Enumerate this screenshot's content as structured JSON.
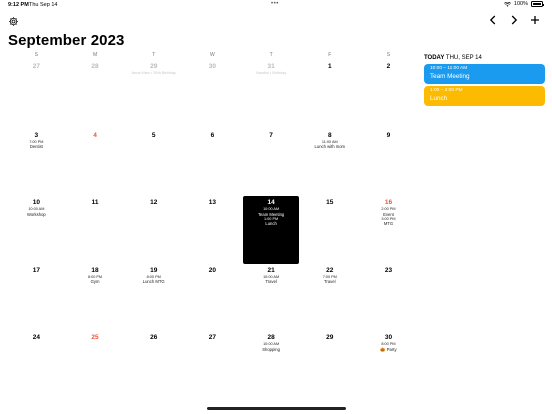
{
  "status_bar": {
    "time": "9:12 PM",
    "date": "Thu Sep 14",
    "dots": "•••",
    "battery": "100%"
  },
  "header": {
    "month_title": "September 2023"
  },
  "weekdays": [
    "S",
    "M",
    "T",
    "W",
    "T",
    "F",
    "S"
  ],
  "weeks": [
    [
      {
        "num": "27",
        "style": "muted",
        "events": []
      },
      {
        "num": "28",
        "style": "muted",
        "events": []
      },
      {
        "num": "29",
        "style": "muted",
        "events": [
          {
            "title": "Anna Marx • 30th Birthday",
            "muted": true
          }
        ]
      },
      {
        "num": "30",
        "style": "muted",
        "events": []
      },
      {
        "num": "31",
        "style": "muted",
        "events": [
          {
            "title": "Nandini • Birthday",
            "muted": true
          }
        ]
      },
      {
        "num": "1",
        "style": "normal",
        "events": []
      },
      {
        "num": "2",
        "style": "normal",
        "events": []
      }
    ],
    [
      {
        "num": "3",
        "style": "normal",
        "events": [
          {
            "time": "7:00 PM",
            "title": "Dentist"
          }
        ]
      },
      {
        "num": "4",
        "style": "red",
        "events": []
      },
      {
        "num": "5",
        "style": "normal",
        "events": []
      },
      {
        "num": "6",
        "style": "normal",
        "events": []
      },
      {
        "num": "7",
        "style": "normal",
        "events": []
      },
      {
        "num": "8",
        "style": "normal",
        "events": [
          {
            "time": "11:00 AM",
            "title": "Lunch with mom"
          }
        ]
      },
      {
        "num": "9",
        "style": "normal",
        "events": []
      }
    ],
    [
      {
        "num": "10",
        "style": "normal",
        "events": [
          {
            "time": "10:00 AM",
            "title": "Workshop"
          }
        ]
      },
      {
        "num": "11",
        "style": "normal",
        "events": []
      },
      {
        "num": "12",
        "style": "normal",
        "events": []
      },
      {
        "num": "13",
        "style": "normal",
        "events": []
      },
      {
        "num": "14",
        "style": "selected",
        "events": [
          {
            "time": "10:00 AM",
            "title": "Team Meeting"
          },
          {
            "time": "1:00 PM",
            "title": "Lunch"
          }
        ]
      },
      {
        "num": "15",
        "style": "normal",
        "events": []
      },
      {
        "num": "16",
        "style": "red",
        "events": [
          {
            "time": "2:00 PM",
            "title": "Event"
          },
          {
            "time": "3:00 PM",
            "title": "MTG"
          }
        ]
      }
    ],
    [
      {
        "num": "17",
        "style": "normal",
        "events": []
      },
      {
        "num": "18",
        "style": "normal",
        "events": [
          {
            "time": "8:00 PM",
            "title": "Gym"
          }
        ]
      },
      {
        "num": "19",
        "style": "normal",
        "events": [
          {
            "time": "8:00 PM",
            "title": "Lunch MTG"
          }
        ]
      },
      {
        "num": "20",
        "style": "normal",
        "events": []
      },
      {
        "num": "21",
        "style": "normal",
        "events": [
          {
            "time": "10:00 AM",
            "title": "Travel"
          }
        ]
      },
      {
        "num": "22",
        "style": "normal",
        "events": [
          {
            "time": "7:00 PM",
            "title": "Travel"
          }
        ]
      },
      {
        "num": "23",
        "style": "normal",
        "events": []
      }
    ],
    [
      {
        "num": "24",
        "style": "normal",
        "events": []
      },
      {
        "num": "25",
        "style": "red",
        "events": []
      },
      {
        "num": "26",
        "style": "normal",
        "events": []
      },
      {
        "num": "27",
        "style": "normal",
        "events": []
      },
      {
        "num": "28",
        "style": "normal",
        "events": [
          {
            "time": "10:00 AM",
            "title": "Shopping"
          }
        ]
      },
      {
        "num": "29",
        "style": "normal",
        "events": []
      },
      {
        "num": "30",
        "style": "normal",
        "events": [
          {
            "time": "8:00 PM",
            "title": "🎃 Party"
          }
        ]
      }
    ]
  ],
  "sidebar": {
    "today_label": "TODAY",
    "today_date": "THU, SEP 14",
    "events": [
      {
        "time": "10:00 – 11:00 AM",
        "title": "Team Meeting",
        "color": "#1a9bf0"
      },
      {
        "time": "1:00 – 2:00 PM",
        "title": "Lunch",
        "color": "#fcbb00"
      }
    ]
  },
  "colors": {
    "accent_red": "#f0503a",
    "selected_bg": "#000000",
    "muted": "#bbbbbb"
  },
  "icons": {
    "settings": "gear-icon",
    "prev": "chevron-left-icon",
    "next": "chevron-right-icon",
    "add": "plus-icon",
    "wifi": "wifi-icon",
    "battery": "battery-icon"
  }
}
